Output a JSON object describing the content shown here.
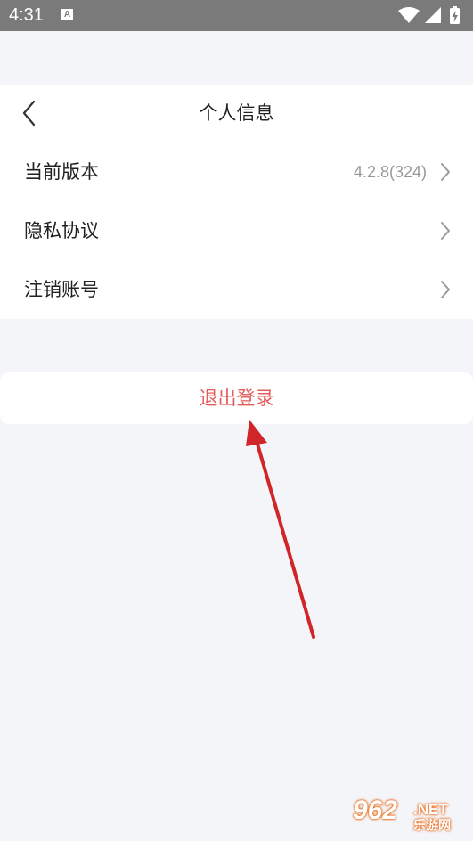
{
  "status_bar": {
    "time": "4:31",
    "notification_icon": "a-icon",
    "notification_letter": "A",
    "wifi_icon": "wifi-icon",
    "signal_icon": "signal-icon",
    "battery_icon": "battery-charging-icon"
  },
  "header": {
    "back_icon": "chevron-left-icon",
    "title": "个人信息"
  },
  "settings": {
    "items": [
      {
        "label": "当前版本",
        "value": "4.2.8(324)",
        "icon": "chevron-right-icon"
      },
      {
        "label": "隐私协议",
        "value": "",
        "icon": "chevron-right-icon"
      },
      {
        "label": "注销账号",
        "value": "",
        "icon": "chevron-right-icon"
      }
    ]
  },
  "logout": {
    "label": "退出登录",
    "color": "#e55b5b"
  },
  "annotation": {
    "arrow_color": "#d0262a",
    "icon": "red-arrow-annotation"
  },
  "watermark": {
    "number": "962",
    "domain": ".NET",
    "site": "乐游网"
  },
  "colors": {
    "background": "#f4f5f9",
    "card": "#ffffff",
    "status_bar": "#7a7a7a",
    "primary_text": "#222222",
    "secondary_text": "#999999",
    "chevron": "#9a9a9a"
  }
}
